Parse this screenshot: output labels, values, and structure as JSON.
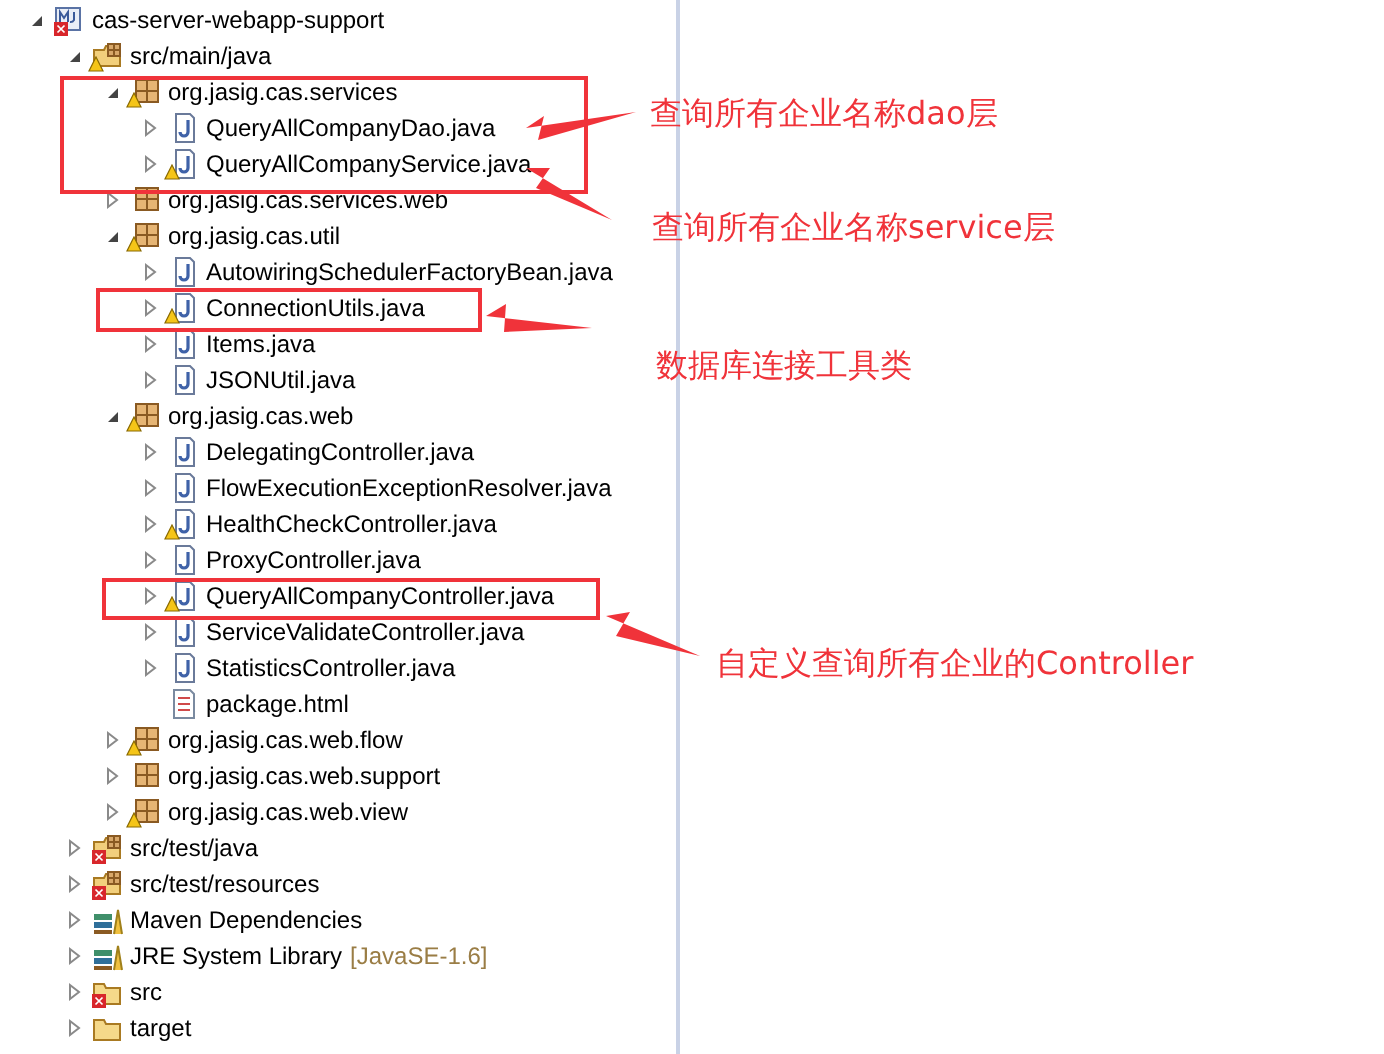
{
  "tree": [
    {
      "label": "cas-server-webapp-support",
      "kind": "project",
      "expanded": true,
      "warning": false,
      "error": true,
      "children": [
        {
          "label": "src/main/java",
          "kind": "source-folder",
          "expanded": true,
          "warning": true,
          "error": false,
          "children": [
            {
              "label": "org.jasig.cas.services",
              "kind": "package",
              "expanded": true,
              "warning": true,
              "error": false,
              "children": [
                {
                  "label": "QueryAllCompanyDao.java",
                  "kind": "java",
                  "expanded": false,
                  "warning": false,
                  "error": false
                },
                {
                  "label": "QueryAllCompanyService.java",
                  "kind": "java",
                  "expanded": false,
                  "warning": true,
                  "error": false
                }
              ]
            },
            {
              "label": "org.jasig.cas.services.web",
              "kind": "package",
              "expanded": false,
              "warning": false,
              "error": false
            },
            {
              "label": "org.jasig.cas.util",
              "kind": "package",
              "expanded": true,
              "warning": true,
              "error": false,
              "children": [
                {
                  "label": "AutowiringSchedulerFactoryBean.java",
                  "kind": "java",
                  "expanded": false,
                  "warning": false,
                  "error": false
                },
                {
                  "label": "ConnectionUtils.java",
                  "kind": "java",
                  "expanded": false,
                  "warning": true,
                  "error": false
                },
                {
                  "label": "Items.java",
                  "kind": "java",
                  "expanded": false,
                  "warning": false,
                  "error": false
                },
                {
                  "label": "JSONUtil.java",
                  "kind": "java",
                  "expanded": false,
                  "warning": false,
                  "error": false
                }
              ]
            },
            {
              "label": "org.jasig.cas.web",
              "kind": "package",
              "expanded": true,
              "warning": true,
              "error": false,
              "children": [
                {
                  "label": "DelegatingController.java",
                  "kind": "java",
                  "expanded": false,
                  "warning": false,
                  "error": false
                },
                {
                  "label": "FlowExecutionExceptionResolver.java",
                  "kind": "java",
                  "expanded": false,
                  "warning": false,
                  "error": false
                },
                {
                  "label": "HealthCheckController.java",
                  "kind": "java",
                  "expanded": false,
                  "warning": true,
                  "error": false
                },
                {
                  "label": "ProxyController.java",
                  "kind": "java",
                  "expanded": false,
                  "warning": false,
                  "error": false
                },
                {
                  "label": "QueryAllCompanyController.java",
                  "kind": "java",
                  "expanded": false,
                  "warning": true,
                  "error": false
                },
                {
                  "label": "ServiceValidateController.java",
                  "kind": "java",
                  "expanded": false,
                  "warning": false,
                  "error": false
                },
                {
                  "label": "StatisticsController.java",
                  "kind": "java",
                  "expanded": false,
                  "warning": false,
                  "error": false
                },
                {
                  "label": "package.html",
                  "kind": "html",
                  "warning": false,
                  "error": false
                }
              ]
            },
            {
              "label": "org.jasig.cas.web.flow",
              "kind": "package",
              "expanded": false,
              "warning": true,
              "error": false
            },
            {
              "label": "org.jasig.cas.web.support",
              "kind": "package",
              "expanded": false,
              "warning": false,
              "error": false
            },
            {
              "label": "org.jasig.cas.web.view",
              "kind": "package",
              "expanded": false,
              "warning": true,
              "error": false
            }
          ]
        },
        {
          "label": "src/test/java",
          "kind": "source-folder",
          "expanded": false,
          "warning": false,
          "error": true
        },
        {
          "label": "src/test/resources",
          "kind": "source-folder",
          "expanded": false,
          "warning": false,
          "error": true
        },
        {
          "label": "Maven Dependencies",
          "kind": "library",
          "expanded": false,
          "warning": false,
          "error": false
        },
        {
          "label": "JRE System Library",
          "suffix": "[JavaSE-1.6]",
          "kind": "library",
          "expanded": false,
          "warning": false,
          "error": false
        },
        {
          "label": "src",
          "kind": "folder",
          "expanded": false,
          "warning": false,
          "error": true
        },
        {
          "label": "target",
          "kind": "folder",
          "expanded": false,
          "warning": false,
          "error": false
        }
      ]
    }
  ],
  "annotations": [
    {
      "text": "查询所有企业名称dao层"
    },
    {
      "text": "查询所有企业名称service层"
    },
    {
      "text": "数据库连接工具类"
    },
    {
      "text": "自定义查询所有企业的Controller"
    }
  ]
}
